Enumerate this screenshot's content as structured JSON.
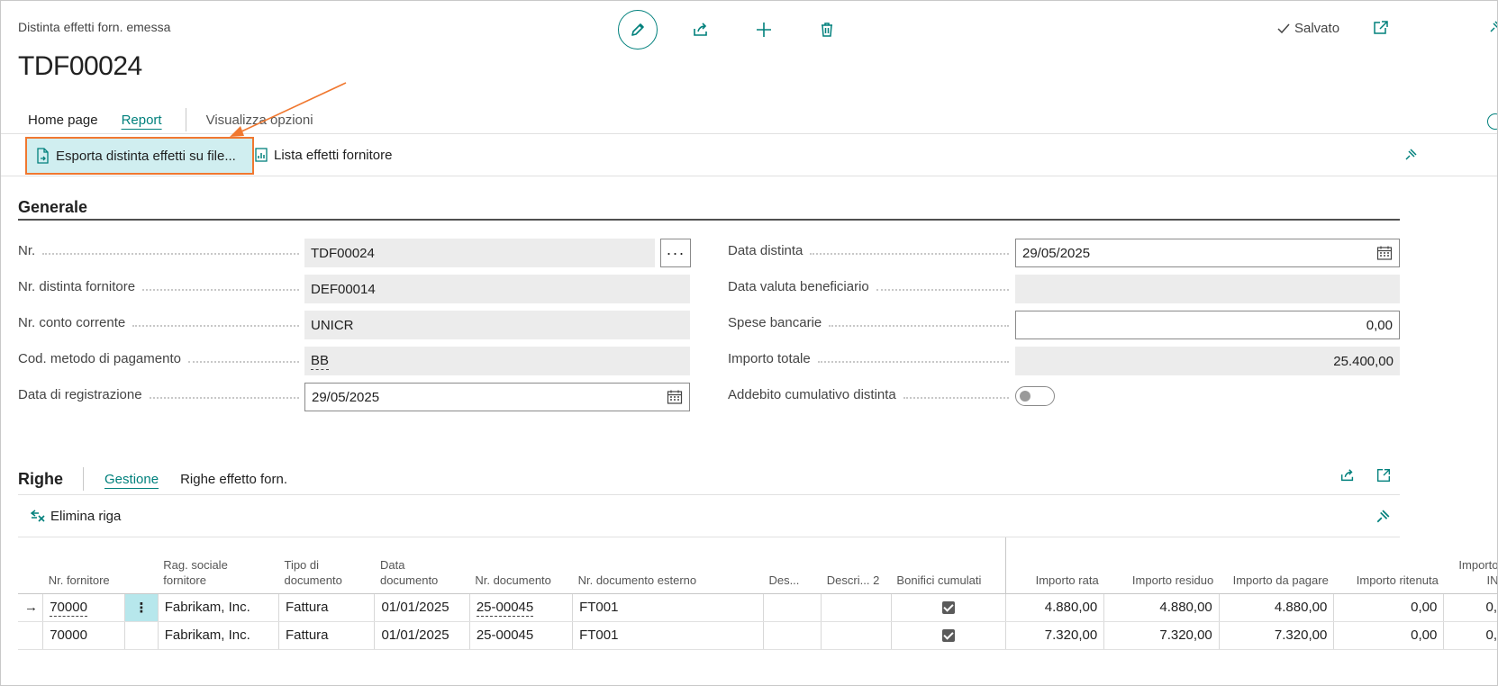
{
  "header": {
    "caption": "Distinta effetti forn. emessa",
    "title": "TDF00024",
    "saved_label": "Salvato"
  },
  "icons": {
    "edit": "pencil-icon",
    "share": "share-icon",
    "new": "plus-icon",
    "delete": "trash-icon",
    "saved": "checkmark-icon",
    "popout": "popout-icon",
    "pin": "pin-icon",
    "export_file": "file-export-icon",
    "report": "report-icon",
    "delete_line": "delete-line-icon",
    "calendar": "calendar-icon",
    "expand": "expand-icon"
  },
  "nav": {
    "tabs": [
      {
        "label": "Home page"
      },
      {
        "label": "Report"
      },
      {
        "label": "Visualizza opzioni"
      }
    ]
  },
  "actions": {
    "primary_label": "Esporta distinta effetti su file...",
    "secondary_label": "Lista effetti fornitore"
  },
  "general": {
    "title": "Generale",
    "left": [
      {
        "label": "Nr.",
        "value": "TDF00024"
      },
      {
        "label": "Nr. distinta fornitore",
        "value": "DEF00014"
      },
      {
        "label": "Nr. conto corrente",
        "value": "UNICR"
      },
      {
        "label": "Cod. metodo di pagamento",
        "value": "BB"
      },
      {
        "label": "Data di registrazione",
        "value": "29/05/2025"
      }
    ],
    "right": [
      {
        "label": "Data distinta",
        "value": "29/05/2025"
      },
      {
        "label": "Data valuta beneficiario",
        "value": ""
      },
      {
        "label": "Spese bancarie",
        "value": "0,00"
      },
      {
        "label": "Importo totale",
        "value": "25.400,00"
      },
      {
        "label": "Addebito cumulativo distinta",
        "value": ""
      }
    ],
    "ellipsis": "···",
    "toggle_on": false
  },
  "lines": {
    "title": "Righe",
    "tabs": [
      {
        "label": "Gestione"
      },
      {
        "label": "Righe effetto forn."
      }
    ],
    "delete_label": "Elimina riga",
    "columns": [
      "Nr. fornitore",
      "Rag. sociale fornitore",
      "Tipo di documento",
      "Data documento",
      "Nr. documento",
      "Nr. documento esterno",
      "Des...",
      "Descri... 2",
      "Bonifici cumulati",
      "Importo rata",
      "Importo residuo",
      "Importo da pagare",
      "Importo ritenuta",
      "Importo IN"
    ],
    "rows": [
      {
        "marker": "→",
        "menu": "⋮",
        "vendor_no": "70000",
        "vendor_name": "Fabrikam, Inc.",
        "doc_type": "Fattura",
        "doc_date": "01/01/2025",
        "doc_no": "25-00045",
        "ext_doc_no": "FT001",
        "desc": "",
        "desc2": "",
        "cumulative": true,
        "installment": "4.880,00",
        "remaining": "4.880,00",
        "to_pay": "4.880,00",
        "withholding": "0,00",
        "inps": "0,"
      },
      {
        "marker": "",
        "menu": "",
        "vendor_no": "70000",
        "vendor_name": "Fabrikam, Inc.",
        "doc_type": "Fattura",
        "doc_date": "01/01/2025",
        "doc_no": "25-00045",
        "ext_doc_no": "FT001",
        "desc": "",
        "desc2": "",
        "cumulative": true,
        "installment": "7.320,00",
        "remaining": "7.320,00",
        "to_pay": "7.320,00",
        "withholding": "0,00",
        "inps": "0,"
      }
    ]
  },
  "colors": {
    "accent": "#00807c",
    "highlight_border": "#f07830",
    "highlight_fill": "#d0eef0",
    "annotation_arrow": "#f07830"
  }
}
